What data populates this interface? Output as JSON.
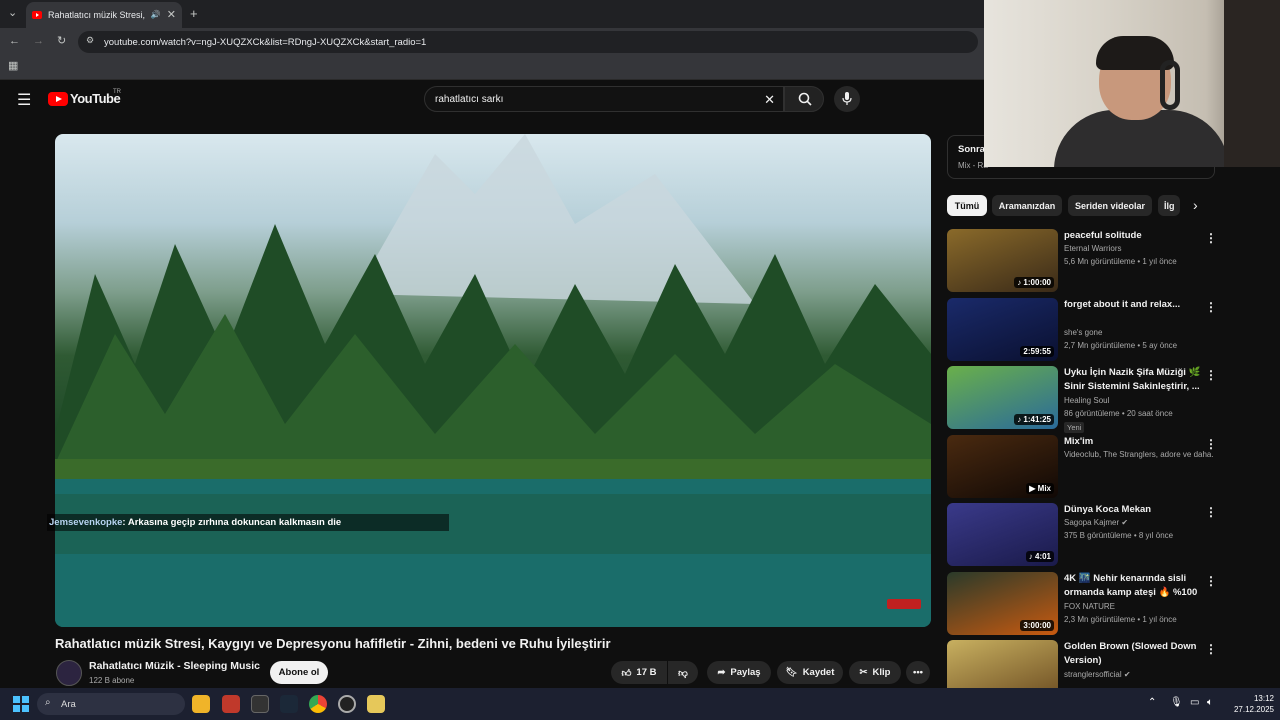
{
  "browser": {
    "tab_title": "Rahatlatıcı müzik Stresi, Kay",
    "url": "youtube.com/watch?v=ngJ-XUQZXCk&list=RDngJ-XUQZXCk&start_radio=1"
  },
  "header": {
    "logo_text": "YouTube",
    "logo_region": "TR",
    "search_value": "rahatlatıcı sarkı"
  },
  "player": {
    "overlay_user": "Jemsevenkopke",
    "overlay_text": " : Arkasına geçip zırhına dokuncan kalkmasın die"
  },
  "video": {
    "title": "Rahatlatıcı müzik Stresi, Kaygıyı ve Depresyonu hafifletir - Zihni, bedeni ve Ruhu İyileştirir",
    "channel": "Rahatlatıcı Müzik - Sleeping Music",
    "subscribers": "122 B abone",
    "subscribe_label": "Abone ol",
    "like_count": "17 B",
    "share_label": "Paylaş",
    "save_label": "Kaydet",
    "clip_label": "Klip",
    "more_label": "•••"
  },
  "upnext": {
    "label": "Sonra",
    "subtitle": "Mix - Ra"
  },
  "chips": [
    "Tümü",
    "Aramanızdan",
    "Seriden videolar",
    "İlg"
  ],
  "recommendations": [
    {
      "title": "peaceful solitude",
      "channel": "Eternal Warriors",
      "meta": "5,6 Mn görüntüleme • 1 yıl önce",
      "duration": "♪ 1:00:00",
      "badge": "",
      "colors": [
        "#8a6a2a",
        "#3a2a18"
      ]
    },
    {
      "title": "forget about it and relax...",
      "channel": "she's gone",
      "meta": "2,7 Mn görüntüleme • 5 ay önce",
      "duration": "2:59:55",
      "badge": "",
      "colors": [
        "#1a2a6a",
        "#0a1030"
      ]
    },
    {
      "title": "Uyku İçin Nazik Şifa Müziği 🌿 Sinir Sistemini Sakinleştirir, ...",
      "channel": "Healing Soul",
      "meta": "86 görüntüleme • 20 saat önce",
      "duration": "♪ 1:41:25",
      "badge": "Yeni",
      "colors": [
        "#6ab04a",
        "#2a6a9a"
      ]
    },
    {
      "title": "Mix'im",
      "channel": "",
      "meta": "Videoclub, The Stranglers, adore ve daha...",
      "duration": "▶ Mix",
      "badge": "",
      "colors": [
        "#4a2a10",
        "#100805"
      ]
    },
    {
      "title": "Dünya Koca Mekan",
      "channel": "Sagopa Kajmer ✔",
      "meta": "375 B görüntüleme • 8 yıl önce",
      "duration": "♪ 4:01",
      "badge": "",
      "colors": [
        "#3a3a8a",
        "#1a1a4a"
      ]
    },
    {
      "title": "4K 🌃 Nehir kenarında sisli ormanda kamp ateşi 🔥 %100 ...",
      "channel": "FOX NATURE",
      "meta": "2,3 Mn görüntüleme • 1 yıl önce",
      "duration": "3:00:00",
      "badge": "",
      "colors": [
        "#2a3a2a",
        "#c85a10"
      ]
    },
    {
      "title": "Golden Brown (Slowed Down Version)",
      "channel": "stranglersofficial ✔",
      "meta": "",
      "duration": "",
      "badge": "",
      "colors": [
        "#c8b060",
        "#6a4a20"
      ]
    }
  ],
  "taskbar": {
    "search_placeholder": "Ara",
    "time": "13:12",
    "date": "27.12.2025"
  }
}
